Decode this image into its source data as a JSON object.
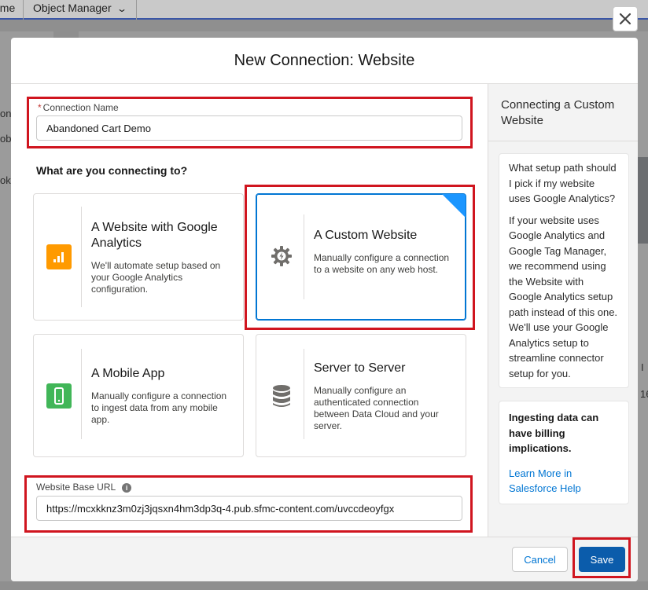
{
  "background": {
    "tabs": {
      "home": "ome",
      "object_manager": "Object Manager"
    },
    "fragments": [
      "ons",
      "obi",
      "ok",
      "I",
      "16"
    ]
  },
  "modal": {
    "title": "New Connection: Website",
    "close_icon": "close-icon",
    "connection_name": {
      "label": "Connection Name",
      "required_marker": "*",
      "value": "Abandoned Cart Demo"
    },
    "section_title": "What are you connecting to?",
    "tiles": [
      {
        "title": "A Website with Google Analytics",
        "description": "We'll automate setup based on your Google Analytics configuration.",
        "icon": "bar-chart-icon",
        "color": "#ff9a00",
        "selected": false
      },
      {
        "title": "A Custom Website",
        "description": "Manually configure a connection to a website on any web host.",
        "icon": "gear-bolt-icon",
        "color": "#706e6b",
        "selected": true
      },
      {
        "title": "A Mobile App",
        "description": "Manually configure a connection to ingest data from any mobile app.",
        "icon": "mobile-icon",
        "color": "#41b658",
        "selected": false
      },
      {
        "title": "Server to Server",
        "description": "Manually configure an authenticated connection between Data Cloud and your server.",
        "icon": "database-icon",
        "color": "#706e6b",
        "selected": false
      }
    ],
    "website_url": {
      "label": "Website Base URL",
      "info_icon": "info-icon",
      "value": "https://mcxkknz3m0zj3jqsxn4hm3dp3q-4.pub.sfmc-content.com/uvccdeoyfgx"
    },
    "side_panel": {
      "title": "Connecting a Custom Website",
      "question": "What setup path should I pick if my website uses Google Analytics?",
      "answer": "If your website uses Google Analytics and Google Tag Manager, we recommend using the Website with Google Analytics setup path instead of this one. We'll use your Google Analytics setup to streamline connector setup for you.",
      "billing_note": "Ingesting data can have billing implications.",
      "link_text": "Learn More in Salesforce Help"
    },
    "footer": {
      "cancel_label": "Cancel",
      "save_label": "Save"
    }
  },
  "colors": {
    "accent": "#0176d3",
    "save_button": "#0b5cab",
    "highlight": "#d0151f",
    "overlay": "#8f8f8f"
  }
}
